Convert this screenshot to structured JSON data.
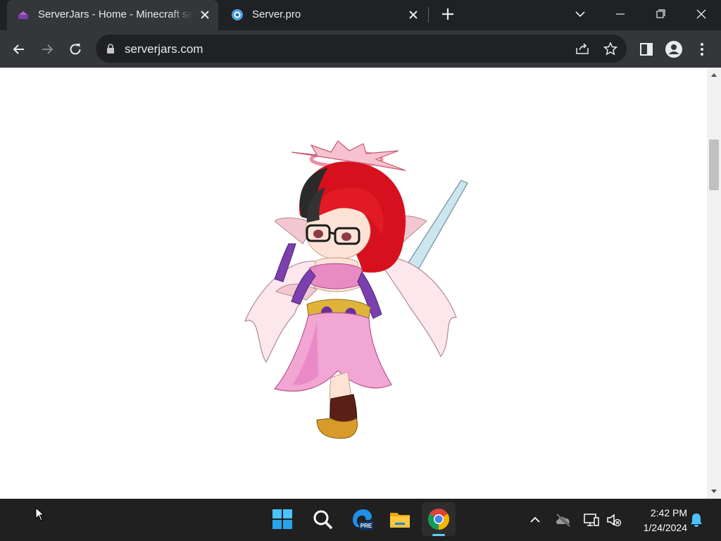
{
  "browser": {
    "tabs": [
      {
        "title": "ServerJars - Home - Minecraft server jars",
        "active": true
      },
      {
        "title": "Server.pro",
        "active": false
      }
    ],
    "address_bar": {
      "url": "serverjars.com"
    }
  },
  "page": {
    "artwork": "chibi-angel-character-with-sword"
  },
  "taskbar": {
    "time": "2:42 PM",
    "date": "1/24/2024"
  },
  "colors": {
    "tabstrip": "#202124",
    "toolbar": "#35363a",
    "taskbar": "#202020",
    "chrome_accent": "#8ab4f8"
  }
}
